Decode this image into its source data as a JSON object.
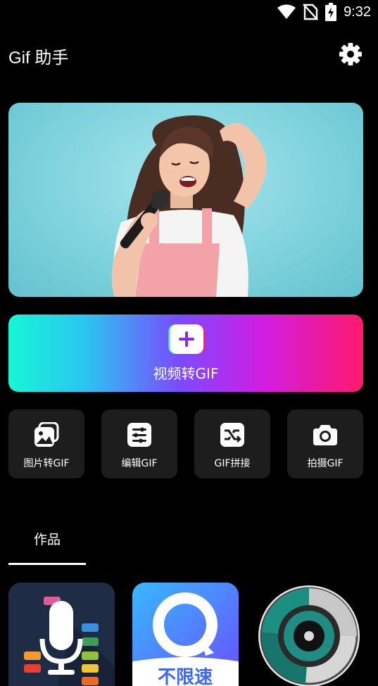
{
  "status_bar": {
    "time": "9:32"
  },
  "header": {
    "title": "Gif 助手",
    "settings_icon": "gear-icon"
  },
  "banner": {
    "image": "woman-singing-microphone"
  },
  "convert": {
    "label": "视频转GIF",
    "icon": "plus-icon",
    "colors": [
      "#17f5d6",
      "#2bc4f0",
      "#7a4bff",
      "#d21ce0",
      "#ff1a6c"
    ]
  },
  "tools": [
    {
      "label": "图片转GIF",
      "icon": "images-icon"
    },
    {
      "label": "编辑GIF",
      "icon": "sliders-icon"
    },
    {
      "label": "GIF拼接",
      "icon": "merge-icon"
    },
    {
      "label": "拍摄GIF",
      "icon": "camera-icon"
    }
  ],
  "tabs": {
    "works": "作品"
  },
  "works": [
    {
      "icon": "voice-recorder-app-icon"
    },
    {
      "icon": "browser-app-icon",
      "text": "不限速"
    },
    {
      "icon": "camera-lens-app-icon"
    }
  ]
}
